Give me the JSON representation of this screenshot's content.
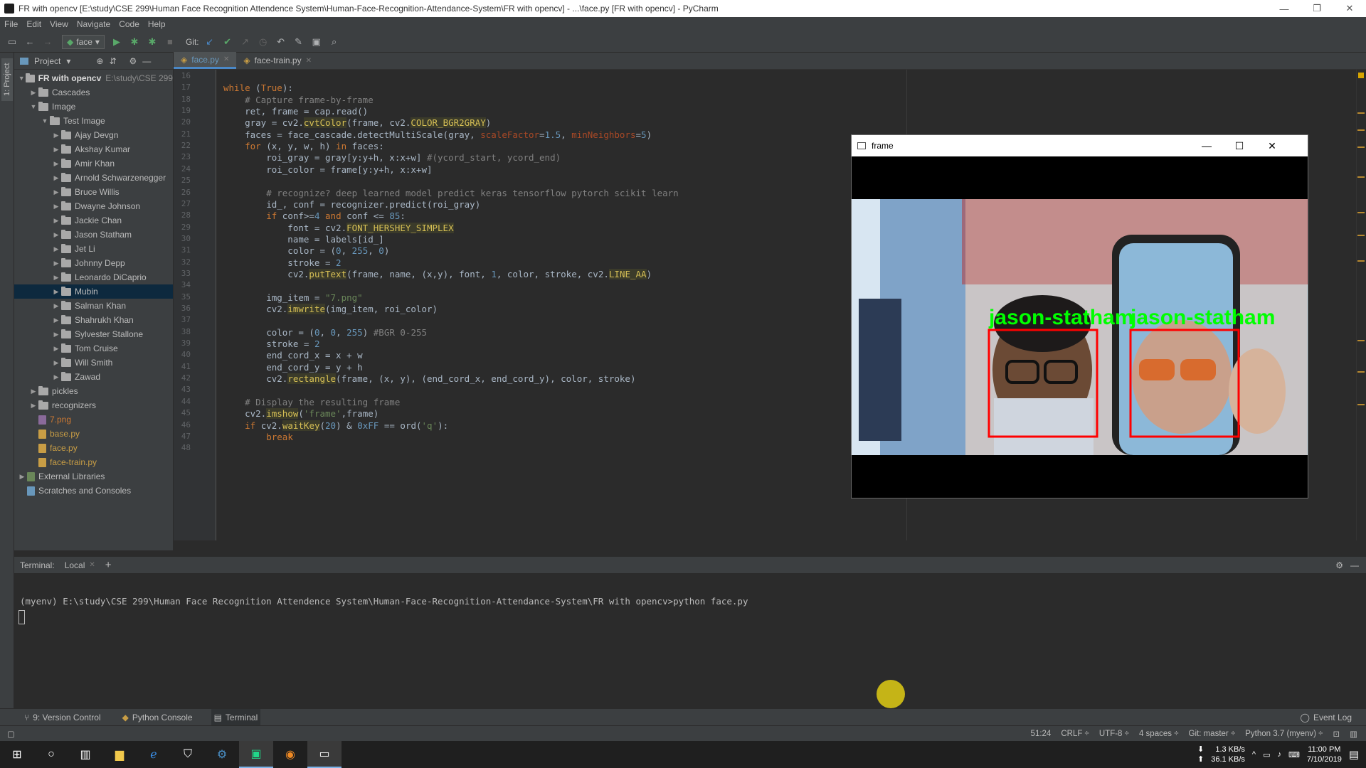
{
  "window": {
    "title": "FR with opencv [E:\\study\\CSE 299\\Human Face Recognition Attendence System\\Human-Face-Recognition-Attendance-System\\FR with opencv] - ...\\face.py [FR with opencv] - PyCharm",
    "minimize": "—",
    "restore": "❐",
    "close": "✕"
  },
  "menu": [
    "File",
    "Edit",
    "View",
    "Navigate",
    "Code",
    "Help"
  ],
  "toolbar": {
    "run_config": "face",
    "git_label": "Git:"
  },
  "left_strip_tab": "1: Project",
  "project": {
    "header": "Project",
    "root_name": "FR with opencv",
    "root_path": "E:\\study\\CSE 299",
    "nodes": [
      {
        "label": "Cascades",
        "level": 1,
        "type": "folder"
      },
      {
        "label": "Image",
        "level": 1,
        "type": "folder",
        "open": true
      },
      {
        "label": "Test Image",
        "level": 2,
        "type": "folder",
        "open": true
      },
      {
        "label": "Ajay Devgn",
        "level": 3,
        "type": "folder"
      },
      {
        "label": "Akshay Kumar",
        "level": 3,
        "type": "folder"
      },
      {
        "label": "Amir Khan",
        "level": 3,
        "type": "folder"
      },
      {
        "label": "Arnold Schwarzenegger",
        "level": 3,
        "type": "folder"
      },
      {
        "label": "Bruce Willis",
        "level": 3,
        "type": "folder"
      },
      {
        "label": "Dwayne Johnson",
        "level": 3,
        "type": "folder"
      },
      {
        "label": "Jackie Chan",
        "level": 3,
        "type": "folder"
      },
      {
        "label": "Jason Statham",
        "level": 3,
        "type": "folder"
      },
      {
        "label": "Jet Li",
        "level": 3,
        "type": "folder"
      },
      {
        "label": "Johnny Depp",
        "level": 3,
        "type": "folder"
      },
      {
        "label": "Leonardo DiCaprio",
        "level": 3,
        "type": "folder"
      },
      {
        "label": "Mubin",
        "level": 3,
        "type": "folder",
        "selected": true
      },
      {
        "label": "Salman Khan",
        "level": 3,
        "type": "folder"
      },
      {
        "label": "Shahrukh Khan",
        "level": 3,
        "type": "folder"
      },
      {
        "label": "Sylvester Stallone",
        "level": 3,
        "type": "folder"
      },
      {
        "label": "Tom Cruise",
        "level": 3,
        "type": "folder"
      },
      {
        "label": "Will Smith",
        "level": 3,
        "type": "folder"
      },
      {
        "label": "Zawad",
        "level": 3,
        "type": "folder"
      },
      {
        "label": "pickles",
        "level": 1,
        "type": "folder"
      },
      {
        "label": "recognizers",
        "level": 1,
        "type": "folder"
      },
      {
        "label": "7.png",
        "level": 1,
        "type": "png"
      },
      {
        "label": "base.py",
        "level": 1,
        "type": "py"
      },
      {
        "label": "face.py",
        "level": 1,
        "type": "py"
      },
      {
        "label": "face-train.py",
        "level": 1,
        "type": "py"
      },
      {
        "label": "External Libraries",
        "level": 0,
        "type": "lib"
      },
      {
        "label": "Scratches and Consoles",
        "level": 0,
        "type": "scratch"
      }
    ]
  },
  "editor_tabs": [
    {
      "label": "face.py",
      "active": true
    },
    {
      "label": "face-train.py",
      "active": false
    }
  ],
  "code": {
    "first_line": 16,
    "lines": [
      "",
      "while (True):",
      "    # Capture frame-by-frame",
      "    ret, frame = cap.read()",
      "    gray = cv2.cvtColor(frame, cv2.COLOR_BGR2GRAY)",
      "    faces = face_cascade.detectMultiScale(gray, scaleFactor=1.5, minNeighbors=5)",
      "    for (x, y, w, h) in faces:",
      "        roi_gray = gray[y:y+h, x:x+w] #(ycord_start, ycord_end)",
      "        roi_color = frame[y:y+h, x:x+w]",
      "",
      "        # recognize? deep learned model predict keras tensorflow pytorch scikit learn",
      "        id_, conf = recognizer.predict(roi_gray)",
      "        if conf>=4 and conf <= 85:",
      "            font = cv2.FONT_HERSHEY_SIMPLEX",
      "            name = labels[id_]",
      "            color = (0, 255, 0)",
      "            stroke = 2",
      "            cv2.putText(frame, name, (x,y), font, 1, color, stroke, cv2.LINE_AA)",
      "",
      "        img_item = \"7.png\"",
      "        cv2.imwrite(img_item, roi_color)",
      "",
      "        color = (0, 0, 255) #BGR 0-255",
      "        stroke = 2",
      "        end_cord_x = x + w",
      "        end_cord_y = y + h",
      "        cv2.rectangle(frame, (x, y), (end_cord_x, end_cord_y), color, stroke)",
      "",
      "    # Display the resulting frame",
      "    cv2.imshow('frame',frame)",
      "    if cv2.waitKey(20) & 0xFF == ord('q'):",
      "        break",
      ""
    ]
  },
  "frame_window": {
    "title": "frame",
    "label_left": "jason-statham",
    "label_right": "jason-statham",
    "minimize": "—",
    "maximize": "☐",
    "close": "✕"
  },
  "terminal": {
    "header_label": "Terminal:",
    "tab_label": "Local",
    "add": "+",
    "command_line": "(myenv) E:\\study\\CSE 299\\Human Face Recognition Attendence System\\Human-Face-Recognition-Attendance-System\\FR with opencv>python face.py"
  },
  "bottom_tabs": [
    {
      "label": "9: Version Control",
      "icon": "version-control-icon"
    },
    {
      "label": "Python Console",
      "icon": "python-console-icon"
    },
    {
      "label": "Terminal",
      "icon": "terminal-icon",
      "active": true
    }
  ],
  "event_log": "Event Log",
  "status": {
    "position": "51:24",
    "line_sep": "CRLF ÷",
    "encoding": "UTF-8 ÷",
    "indent": "4 spaces ÷",
    "git": "Git: master ÷",
    "interpreter": "Python 3.7 (myenv) ÷"
  },
  "taskbar": {
    "net_down": "1.3 KB/s",
    "net_up": "36.1 KB/s",
    "time": "11:00 PM",
    "date": "7/10/2019"
  },
  "colors": {
    "accent": "#4a88c7",
    "detect_box": "#ff0000",
    "detect_label": "#00ff00"
  }
}
